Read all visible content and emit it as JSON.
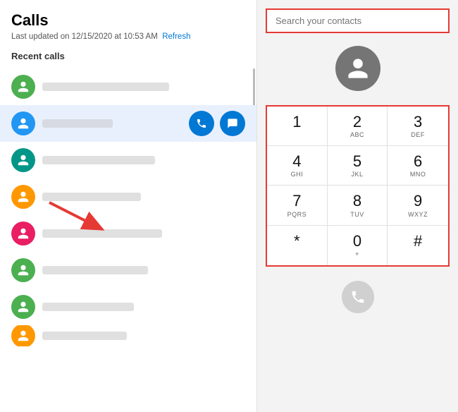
{
  "left": {
    "title": "Calls",
    "last_updated": "Last updated on 12/15/2020 at 10:53 AM",
    "refresh_label": "Refresh",
    "recent_calls_label": "Recent calls",
    "contacts": [
      {
        "color": "#4caf50",
        "id": "contact-1"
      },
      {
        "color": "#2196f3",
        "id": "contact-2",
        "highlighted": true
      },
      {
        "color": "#009688",
        "id": "contact-3"
      },
      {
        "color": "#ff9800",
        "id": "contact-4"
      },
      {
        "color": "#e91e63",
        "id": "contact-5"
      },
      {
        "color": "#4caf50",
        "id": "contact-6"
      },
      {
        "color": "#4caf50",
        "id": "contact-7"
      },
      {
        "color": "#ff9800",
        "id": "contact-8"
      }
    ]
  },
  "right": {
    "search_placeholder": "Search your contacts",
    "dialpad": {
      "keys": [
        {
          "num": "1",
          "letters": ""
        },
        {
          "num": "2",
          "letters": "ABC"
        },
        {
          "num": "3",
          "letters": "DEF"
        },
        {
          "num": "4",
          "letters": "GHI"
        },
        {
          "num": "5",
          "letters": "JKL"
        },
        {
          "num": "6",
          "letters": "MNO"
        },
        {
          "num": "7",
          "letters": "PQRS"
        },
        {
          "num": "8",
          "letters": "TUV"
        },
        {
          "num": "9",
          "letters": "WXYZ"
        },
        {
          "num": "*",
          "letters": ""
        },
        {
          "num": "0",
          "letters": "+"
        },
        {
          "num": "#",
          "letters": ""
        }
      ]
    }
  }
}
